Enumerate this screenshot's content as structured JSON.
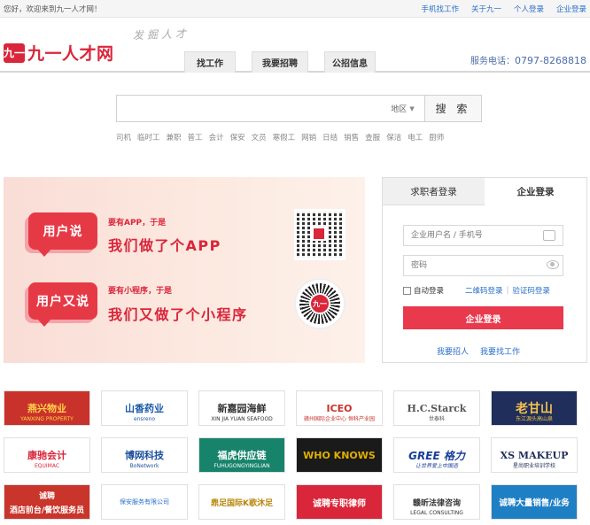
{
  "topbar": {
    "welcome": "您好，欢迎来到九一人才网！",
    "links": [
      "手机找工作",
      "关于九一",
      "个人登录",
      "企业登录"
    ]
  },
  "header": {
    "logo_badge": "九一",
    "logo_text": "九一人才网",
    "slogan": "发掘人才",
    "nav": [
      "找工作",
      "我要招聘",
      "公招信息"
    ],
    "phone_label": "服务电话：",
    "phone_number": "0797-8268818"
  },
  "search": {
    "value": "",
    "region_label": "地区",
    "button_label": "搜 索",
    "hot_keys": [
      "司机",
      "临时工",
      "兼职",
      "普工",
      "会计",
      "保安",
      "文员",
      "寒假工",
      "网销",
      "日结",
      "销售",
      "查服",
      "保洁",
      "电工",
      "厨师"
    ]
  },
  "banner": {
    "bubble1": "用户说",
    "sub1": "要有APP，于是",
    "big1": "我们做了个APP",
    "bubble2": "用户又说",
    "sub2": "要有小程序，于是",
    "big2": "我们又做了个小程序",
    "qr_center": "九一"
  },
  "login": {
    "tab_jobseeker": "求职者登录",
    "tab_company": "企业登录",
    "username_placeholder": "企业用户名 / 手机号",
    "password_placeholder": "密码",
    "auto_login": "自动登录",
    "qr_login": "二维码登录",
    "sep": "|",
    "code_login": "验证码登录",
    "submit": "企业登录",
    "link_hire": "我要招人",
    "link_job": "我要找工作"
  },
  "companies": [
    {
      "name": "燕兴物业",
      "sub": "YANXING PROPERTY"
    },
    {
      "name": "山香药业",
      "sub": "ensreno"
    },
    {
      "name": "新嘉园海鲜",
      "sub": "XIN JIA YUAN SEAFOOD"
    },
    {
      "name": "ICEO",
      "sub": "赣州国际企业中心 恒科产业园"
    },
    {
      "name": "H.C.Starck",
      "sub": "世泰科"
    },
    {
      "name": "老甘山",
      "sub": "东江源头高山泉"
    },
    {
      "name": "康驰会计",
      "sub": "EQUIMAC"
    },
    {
      "name": "博网科技",
      "sub": "BoNetwork"
    },
    {
      "name": "福虎供应链",
      "sub": "FUHUGONGYINGLIAN"
    },
    {
      "name": "WHO KNOWS",
      "sub": "WHO KNOWS"
    },
    {
      "name": "GREE 格力",
      "sub": "让世界爱上中国造"
    },
    {
      "name": "XS MAKEUP",
      "sub": "星尚职业培训学校"
    },
    {
      "name": "诚聘",
      "sub": "酒店前台/餐饮服务员"
    },
    {
      "name": "保安服务有限公司",
      "sub": ""
    },
    {
      "name": "鼎足国际K歌沐足",
      "sub": ""
    },
    {
      "name": "诚聘专职律师",
      "sub": ""
    },
    {
      "name": "赣昕法律咨询",
      "sub": "LEGAL CONSULTING"
    },
    {
      "name": "诚聘大量销售/业务",
      "sub": ""
    }
  ],
  "colors": {
    "brand_red": "#d9263a",
    "link_blue": "#2a6fc9",
    "submit_red": "#e8394d"
  }
}
